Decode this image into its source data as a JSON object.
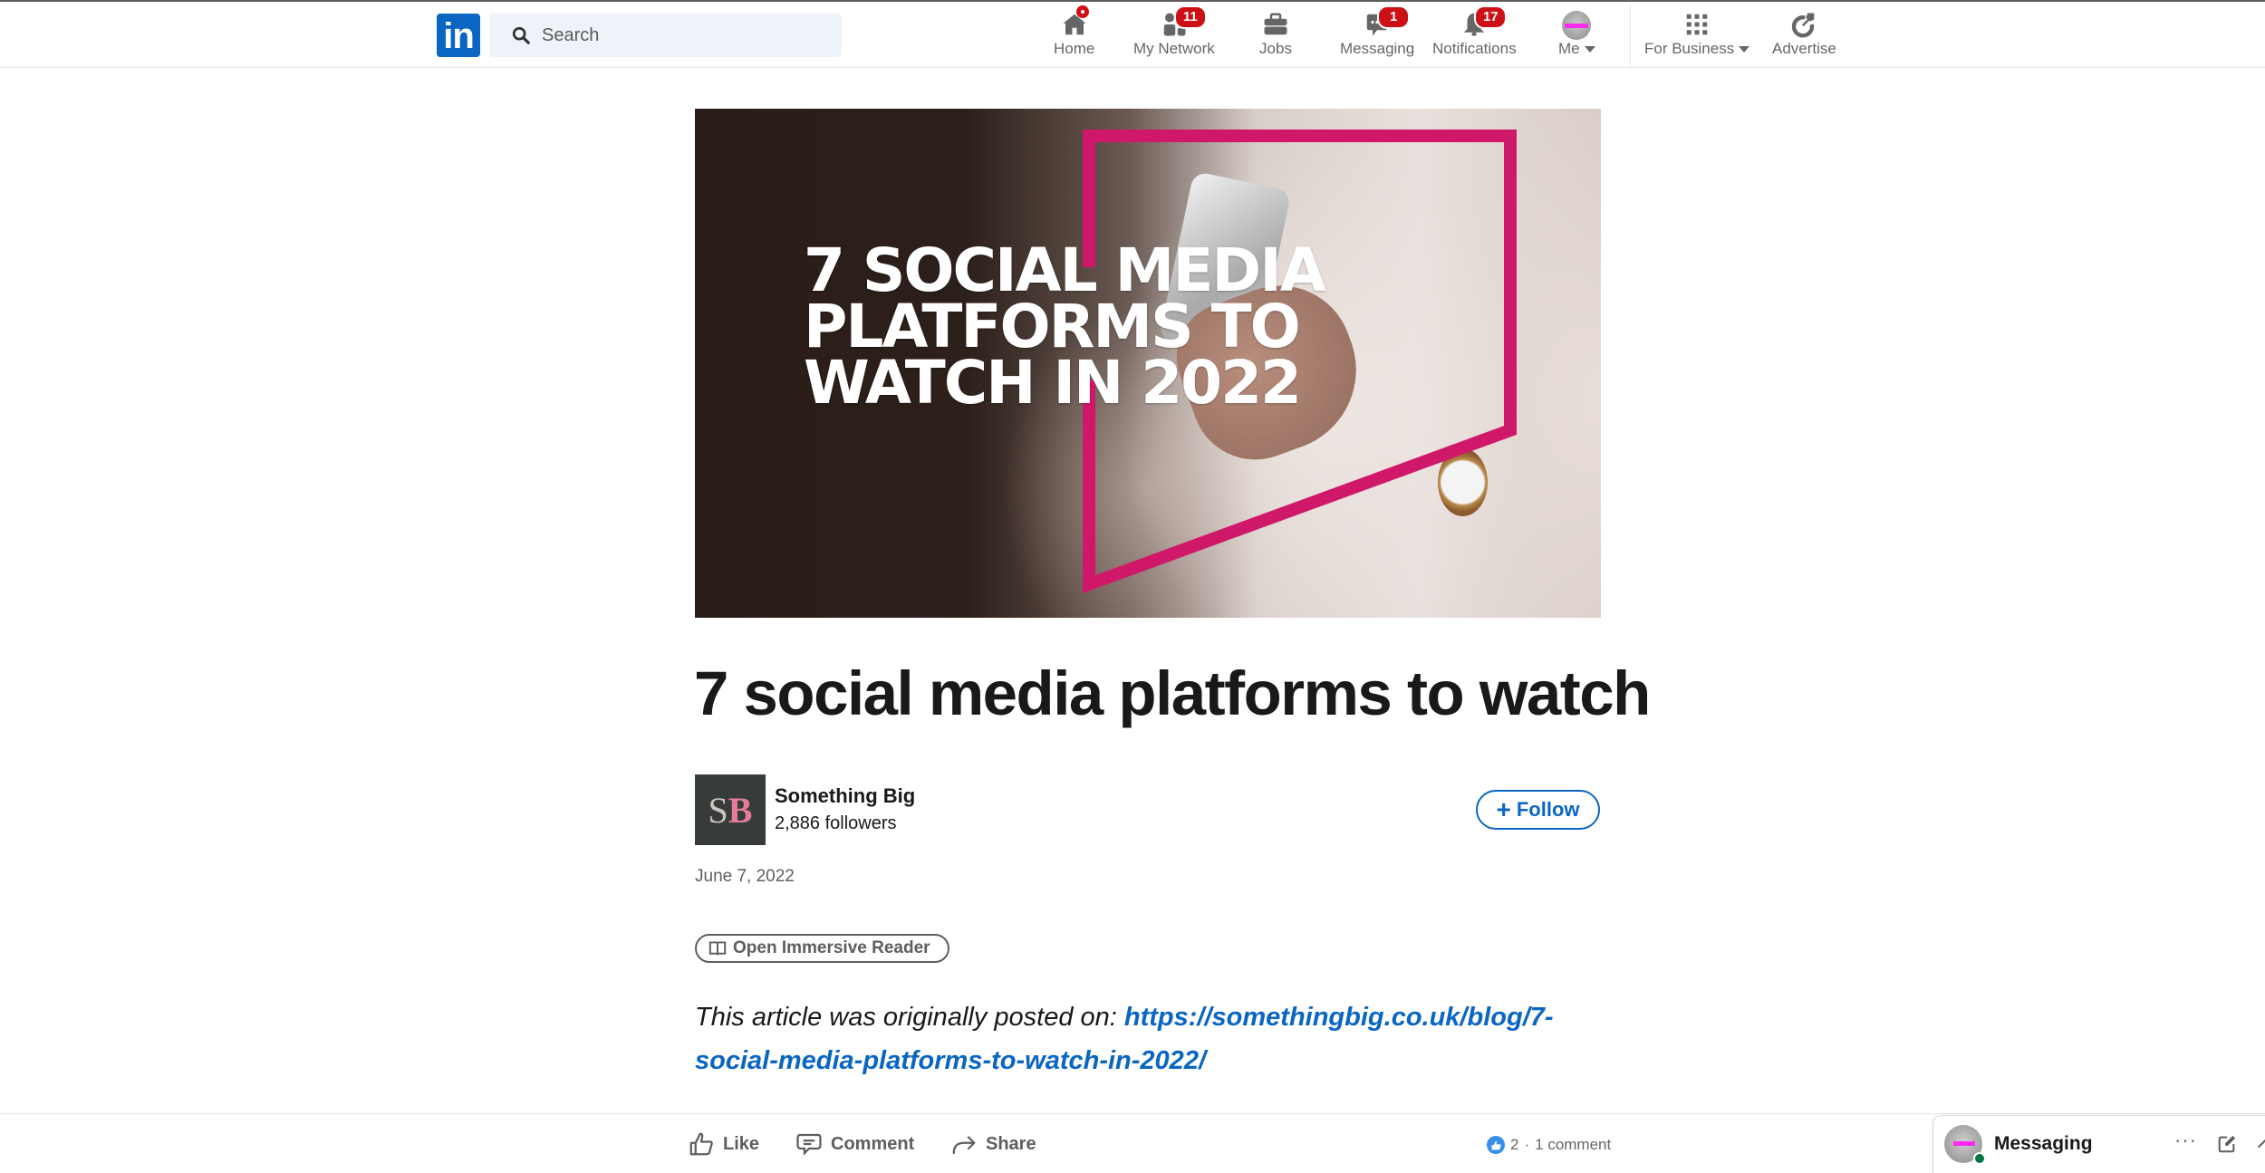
{
  "nav": {
    "logo_text": "in",
    "search": {
      "placeholder": "Search",
      "value": ""
    },
    "items": [
      {
        "label": "Home",
        "icon": "home-icon",
        "badge": "dot"
      },
      {
        "label": "My Network",
        "icon": "my-network-icon",
        "badge": "11"
      },
      {
        "label": "Jobs",
        "icon": "briefcase-icon",
        "badge": ""
      },
      {
        "label": "Messaging",
        "icon": "messaging-icon",
        "badge": "1"
      },
      {
        "label": "Notifications",
        "icon": "bell-icon",
        "badge": "17"
      },
      {
        "label": "Me",
        "icon": "avatar",
        "badge": ""
      },
      {
        "label": "For Business",
        "icon": "grid-icon",
        "badge": ""
      },
      {
        "label": "Advertise",
        "icon": "advertise-icon",
        "badge": ""
      }
    ]
  },
  "article": {
    "cover": {
      "headline": "7 SOCIAL MEDIA\nPLATFORMS TO\nWATCH IN 2022",
      "accent_color": "#d0186a"
    },
    "title": "7 social media platforms to watch",
    "author": {
      "logo_s": "S",
      "logo_b": "B",
      "name": "Something Big",
      "followers": "2,886 followers"
    },
    "follow_label": "Follow",
    "date": "June 7, 2022",
    "immersive_reader_label": "Open Immersive Reader",
    "body_prefix": "This article was originally posted on: ",
    "body_link": "https://somethingbig.co.uk/blog/7-social-media-platforms-to-watch-in-2022/"
  },
  "actions": {
    "like": "Like",
    "comment": "Comment",
    "share": "Share",
    "reactions_count": "2",
    "separator": "·",
    "comments_count": "1 comment"
  },
  "messaging_panel": {
    "title": "Messaging",
    "more": "···"
  },
  "colors": {
    "brand": "#0a66c2",
    "badge": "#cc1016",
    "online": "#057642"
  }
}
